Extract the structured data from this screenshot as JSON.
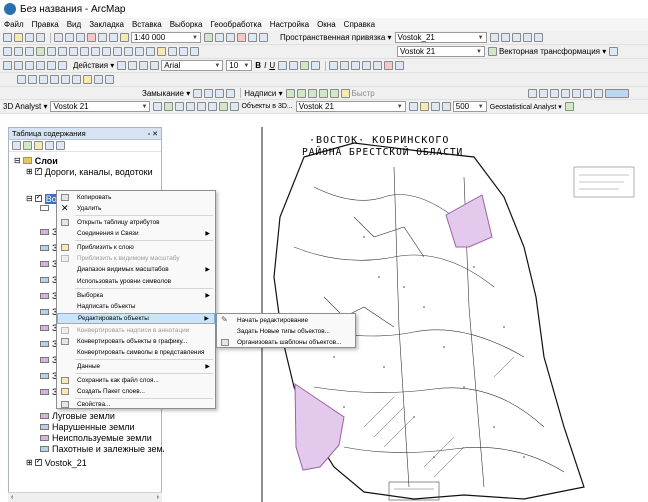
{
  "window": {
    "title": "Без названия - ArcMap"
  },
  "menu": [
    "Файл",
    "Правка",
    "Вид",
    "Закладка",
    "Вставка",
    "Выборка",
    "Геообработка",
    "Настройка",
    "Окна",
    "Справка"
  ],
  "toolbar": {
    "scale": "1:40 000",
    "snapping_label": "Пространственная привязка ▾",
    "snapping_layer": "Vostok_21",
    "georef_layer": "Vostok 21",
    "vector_transform": "Векторная трансформация ▾",
    "actions_label": "Действия ▾",
    "font": "Arial",
    "font_size": "10",
    "zoom_label": "Замыкание ▾",
    "labels_label": "Надписи ▾",
    "quick_label": "Быстр",
    "analyst_label": "3D Analyst ▾",
    "analyst_layer": "Vostok 21",
    "objects_3d_label": "Объекты в 3D...",
    "objects_3d_layer": "Vostok 21",
    "resolution": "500",
    "geostat_label": "Geostatistical Analyst ▾"
  },
  "toc": {
    "title": "Таблица содержания",
    "close": "✕",
    "root": "Слои",
    "layer_rivers": "Дороги, каналы, водотоки",
    "layer_selected": "Вост",
    "layers_bottom": [
      "Луговые земли",
      "Нарушенные земли",
      "Неиспользуемые земли",
      "Пахотные и залежные земли"
    ],
    "raster": "Vostok_21",
    "truncated_label": "Зе"
  },
  "context_menu": {
    "items": [
      {
        "label": "Копировать",
        "disabled": false,
        "submenu": false
      },
      {
        "label": "Удалить",
        "disabled": false,
        "submenu": false
      },
      {
        "label": "Открыть таблицу атрибутов",
        "disabled": false,
        "submenu": false
      },
      {
        "label": "Соединения и Связи",
        "disabled": false,
        "submenu": true
      },
      {
        "label": "Приблизить к слою",
        "disabled": false,
        "submenu": false
      },
      {
        "label": "Приблизить к видимому масштабу",
        "disabled": true,
        "submenu": false
      },
      {
        "label": "Диапазон видимых масштабов",
        "disabled": false,
        "submenu": true
      },
      {
        "label": "Использовать уровни символов",
        "disabled": false,
        "submenu": false
      },
      {
        "label": "Выборка",
        "disabled": false,
        "submenu": true
      },
      {
        "label": "Надписать объекты",
        "disabled": false,
        "submenu": false
      },
      {
        "label": "Редактировать объекты",
        "disabled": false,
        "submenu": true
      },
      {
        "label": "Конвертировать надписи в аннотации",
        "disabled": true,
        "submenu": false
      },
      {
        "label": "Конвертировать объекты в графику...",
        "disabled": false,
        "submenu": false
      },
      {
        "label": "Конвертировать символы в представления",
        "disabled": false,
        "submenu": false
      },
      {
        "label": "Данные",
        "disabled": false,
        "submenu": true
      },
      {
        "label": "Сохранить как файл слоя...",
        "disabled": false,
        "submenu": false
      },
      {
        "label": "Создать Пакет слоев...",
        "disabled": false,
        "submenu": false
      },
      {
        "label": "Свойства...",
        "disabled": false,
        "submenu": false
      }
    ]
  },
  "submenu": {
    "items": [
      "Начать редактирование",
      "Задать Новые типы объектов...",
      "Организовать шаблоны объектов..."
    ]
  },
  "map": {
    "title_line1": "·ВОСТОК· КОБРИНСКОГО",
    "title_line2": "РАЙОНА  БРЕСТСКОЙ  ОБЛАСТИ"
  },
  "colors": {
    "polygon_fill": "#e3c9ec",
    "polygon_stroke": "#a05fa8",
    "toc_header": "#d7e3f2",
    "highlight": "#cde3f7"
  }
}
